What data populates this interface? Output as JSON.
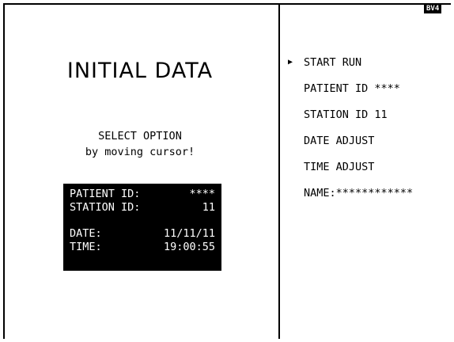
{
  "badge": "BV4",
  "left_panel": {
    "title": "INITIAL DATA",
    "instructions": [
      "SELECT OPTION",
      "by moving cursor!"
    ],
    "info_box": {
      "patient_label": "PATIENT ID:",
      "patient_value": "****",
      "station_label": "STATION ID:",
      "station_value": "11",
      "date_label": "DATE:",
      "date_value": "11/11/11",
      "time_label": "TIME:",
      "time_value": "19:00:55"
    }
  },
  "menu": {
    "cursor": "▶",
    "items": [
      {
        "label": "START RUN"
      },
      {
        "label": "PATIENT ID ****"
      },
      {
        "label": "STATION ID 11"
      },
      {
        "label": "DATE ADJUST"
      },
      {
        "label": "TIME ADJUST"
      },
      {
        "label": "NAME:************"
      }
    ]
  }
}
